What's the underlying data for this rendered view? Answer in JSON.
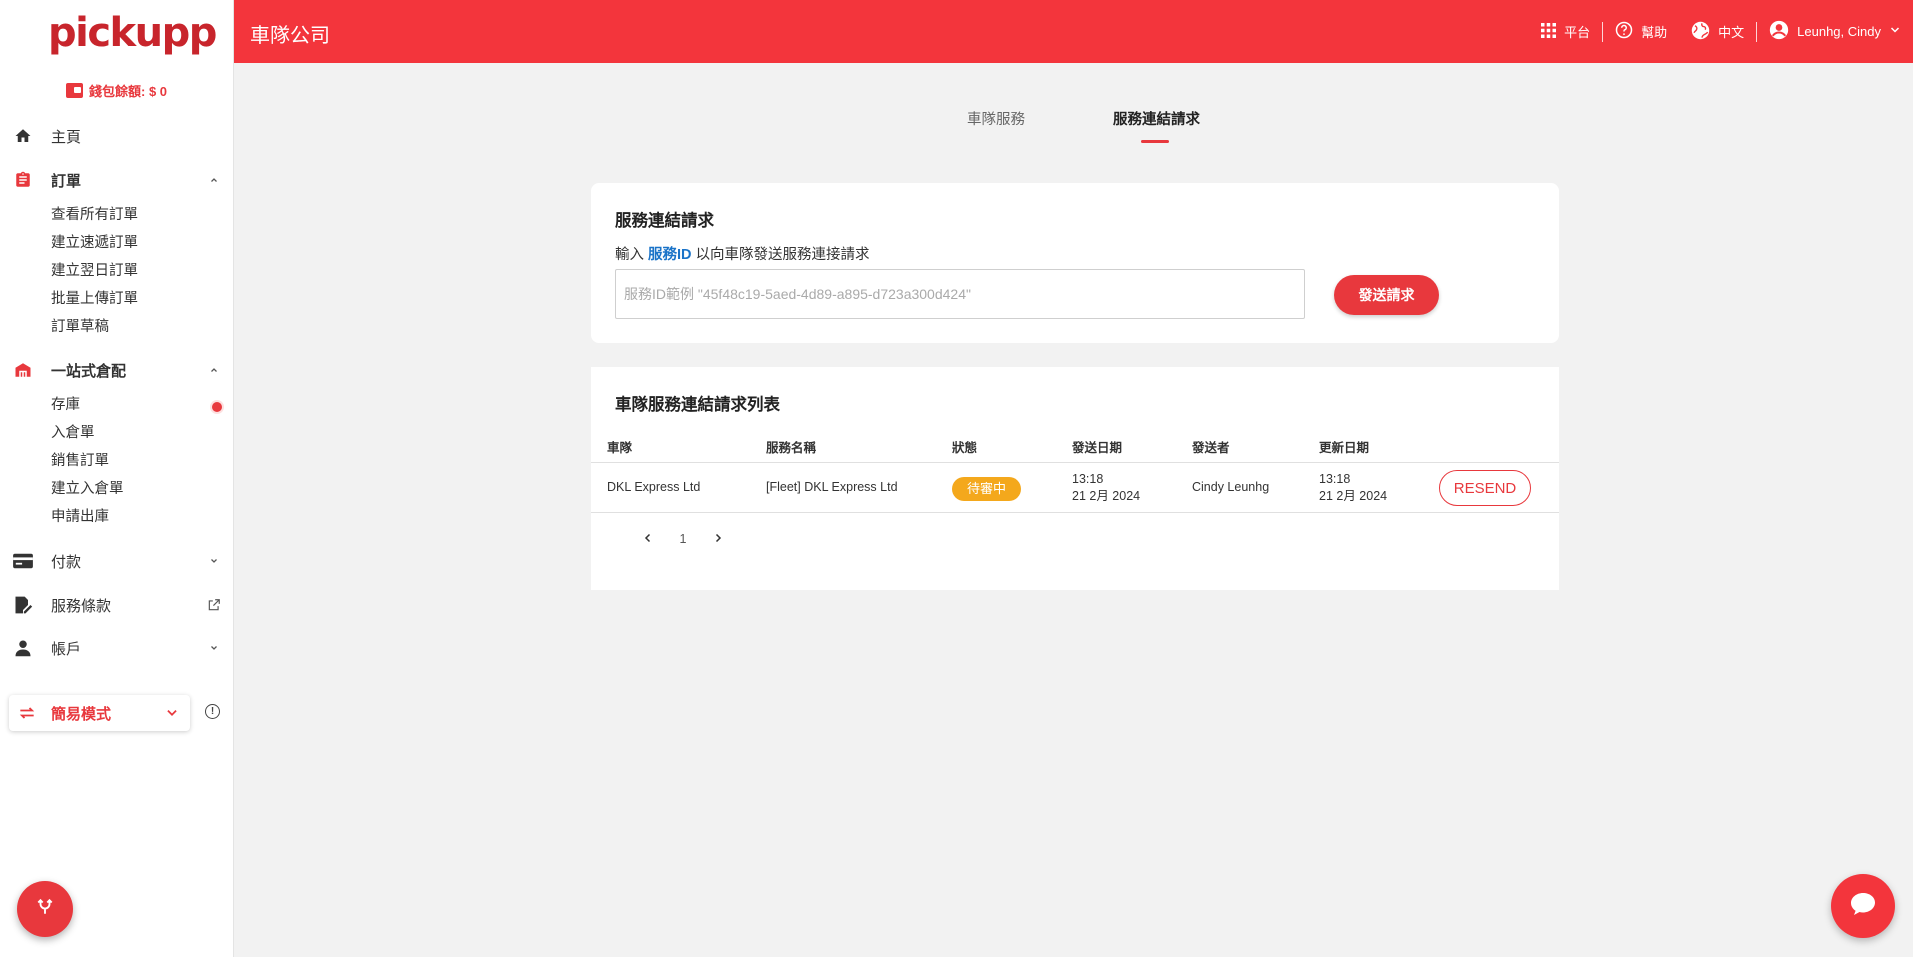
{
  "sidebar": {
    "logo": "pickupp",
    "wallet_label": "錢包餘額: $ 0",
    "nav": {
      "home": "主頁",
      "orders": "訂單",
      "orders_sub": [
        "查看所有訂單",
        "建立速遞訂單",
        "建立翌日訂單",
        "批量上傳訂單",
        "訂單草稿"
      ],
      "warehouse": "一站式倉配",
      "warehouse_sub": [
        "存庫",
        "入倉單",
        "銷售訂單",
        "建立入倉單",
        "申請出庫"
      ],
      "payment": "付款",
      "terms": "服務條款",
      "account": "帳戶"
    },
    "simple_mode": "簡易模式"
  },
  "header": {
    "title": "車隊公司",
    "platform": "平台",
    "help": "幫助",
    "language": "中文",
    "user": "Leunhg, Cindy"
  },
  "tabs": [
    "車隊服務",
    "服務連結請求"
  ],
  "request_card": {
    "title": "服務連結請求",
    "desc_prefix": "輸入",
    "desc_link": "服務ID",
    "desc_suffix": "以向車隊發送服務連接請求",
    "input_placeholder": "服務ID範例 \"45f48c19-5aed-4d89-a895-d723a300d424\"",
    "input_value": "",
    "send_label": "發送請求"
  },
  "list_card": {
    "title": "車隊服務連結請求列表",
    "columns": [
      "車隊",
      "服務名稱",
      "狀態",
      "發送日期",
      "發送者",
      "更新日期"
    ],
    "rows": [
      {
        "fleet": "DKL Express Ltd",
        "service": "[Fleet] DKL Express Ltd",
        "status": "待審中",
        "sent_time": "13:18",
        "sent_date": "21 2月 2024",
        "sender": "Cindy Leunhg",
        "updated_time": "13:18",
        "updated_date": "21 2月 2024",
        "action": "RESEND"
      }
    ],
    "page": "1"
  },
  "colors": {
    "brand_red": "#f3353c",
    "accent_red": "#e8383d",
    "pending_orange": "#f4a81c",
    "link_blue": "#1a73c8"
  },
  "icons": [
    "home-icon",
    "clipboard-icon",
    "warehouse-icon",
    "credit-card-icon",
    "document-sign-icon",
    "external-link-icon",
    "person-icon",
    "swap-icon",
    "info-icon",
    "grid-icon",
    "help-icon",
    "globe-icon",
    "account-circle-icon",
    "chevron-down-icon",
    "chevron-up-icon",
    "chevron-left-icon",
    "chevron-right-icon",
    "fork-icon",
    "chat-bubble-icon"
  ]
}
